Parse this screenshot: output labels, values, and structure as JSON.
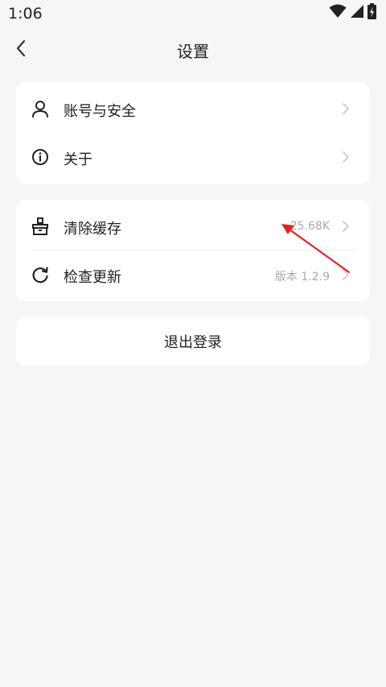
{
  "status_bar": {
    "time": "1:06",
    "icons": [
      "wifi-icon",
      "cellular-signal-icon",
      "battery-charging-icon"
    ]
  },
  "nav": {
    "title": "设置",
    "back_icon": "chevron-left-icon"
  },
  "group1": {
    "items": [
      {
        "label": "账号与安全",
        "icon": "user-icon"
      },
      {
        "label": "关于",
        "icon": "info-icon"
      }
    ]
  },
  "group2": {
    "items": [
      {
        "label": "清除缓存",
        "value": "25.68K",
        "icon": "broom-icon"
      },
      {
        "label": "检查更新",
        "value": "版本 1.2.9",
        "icon": "refresh-icon"
      }
    ]
  },
  "logout": {
    "label": "退出登录"
  },
  "colors": {
    "background": "#f6f6f6",
    "card": "#ffffff",
    "text": "#222222",
    "muted": "#aaaaaa",
    "annotation_arrow": "#e8201f"
  }
}
